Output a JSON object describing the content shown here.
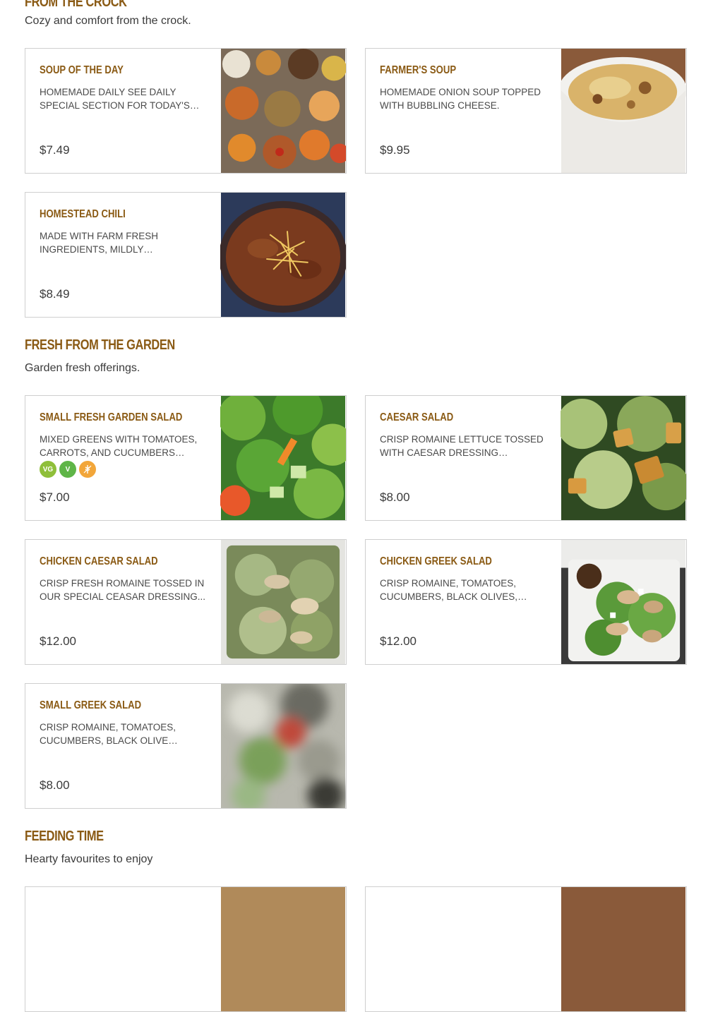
{
  "sections": {
    "crock": {
      "title": "FROM THE CROCK",
      "subtitle": "Cozy and comfort from the crock.",
      "items": [
        {
          "name": "SOUP OF THE DAY",
          "desc": "HOMEMADE DAILY SEE DAILY SPECIAL SECTION FOR TODAY'S FLAVOUR",
          "price": "$7.49"
        },
        {
          "name": "FARMER'S SOUP",
          "desc": "HOMEMADE ONION SOUP TOPPED WITH BUBBLING CHEESE.",
          "price": "$9.95"
        },
        {
          "name": "HOMESTEAD CHILI",
          "desc": "MADE WITH FARM FRESH INGREDIENTS, MILDLY SEASONED...",
          "price": "$8.49"
        }
      ]
    },
    "garden": {
      "title": "FRESH FROM THE GARDEN",
      "subtitle": "Garden fresh offerings.",
      "items": [
        {
          "name": "SMALL FRESH GARDEN SALAD",
          "desc": "MIXED GREENS WITH TOMATOES, CARROTS, AND CUCUMBERS TOPP...",
          "price": "$7.00",
          "badges": [
            "VG",
            "V",
            "GF"
          ]
        },
        {
          "name": "CAESAR SALAD",
          "desc": "CRISP ROMAINE LETTUCE TOSSED WITH CAESAR DRESSING TOPPED...",
          "price": "$8.00"
        },
        {
          "name": "CHICKEN CAESAR SALAD",
          "desc": "CRISP FRESH ROMAINE TOSSED IN OUR SPECIAL CEASAR DRESSING...",
          "price": "$12.00"
        },
        {
          "name": "CHICKEN GREEK SALAD",
          "desc": "CRISP ROMAINE, TOMATOES, CUCUMBERS, BLACK OLIVES, FETA...",
          "price": "$12.00"
        },
        {
          "name": "SMALL GREEK SALAD",
          "desc": "CRISP ROMAINE, TOMATOES, CUCUMBERS, BLACK OLIVE SERVED...",
          "price": "$8.00"
        }
      ]
    },
    "feeding": {
      "title": "FEEDING TIME",
      "subtitle": "Hearty favourites to enjoy"
    }
  },
  "icons": {
    "vegan": "vegan-icon",
    "vegetarian": "vegetarian-icon",
    "gluten_free": "gluten-free-icon"
  },
  "colors": {
    "accent": "#8a5a14",
    "border": "#cfcfcf"
  }
}
